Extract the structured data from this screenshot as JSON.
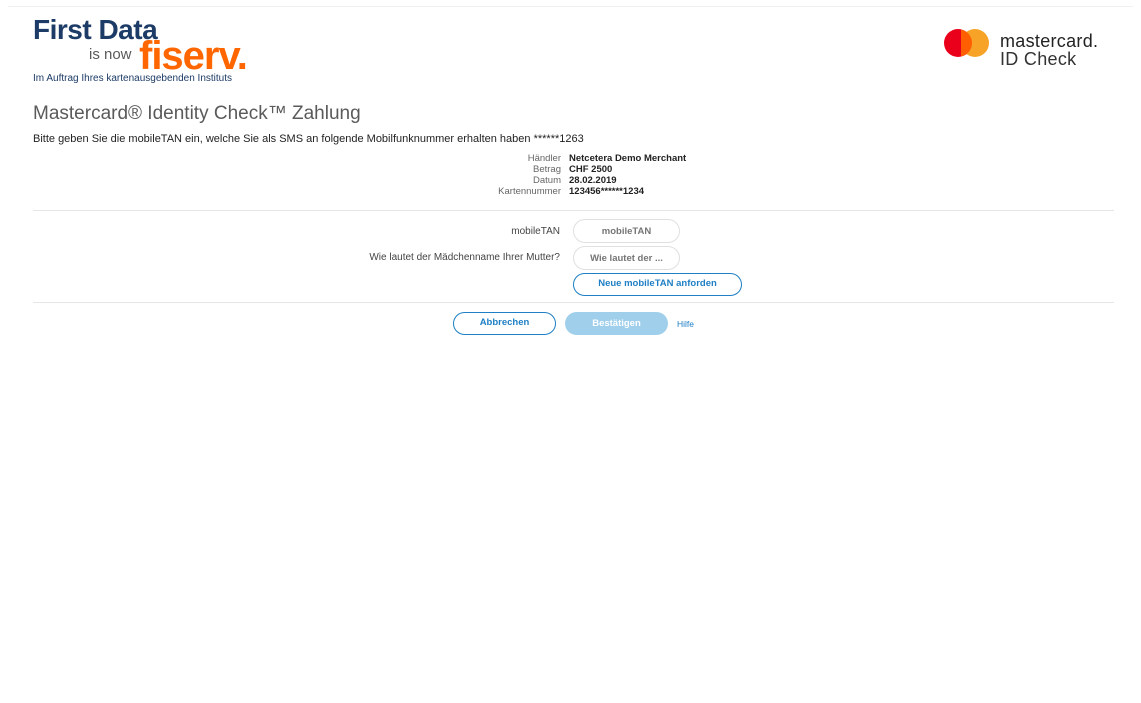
{
  "header": {
    "first_data": "First Data",
    "is_now": "is now",
    "fiserv": "fiserv.",
    "issuer_subtitle": "Im Auftrag Ihres kartenausgebenden Instituts",
    "mc_name": "mastercard.",
    "mc_sub": "ID Check"
  },
  "page": {
    "title": "Mastercard® Identity Check™ Zahlung",
    "instruction": "Bitte geben Sie die mobileTAN ein, welche Sie als SMS an folgende Mobilfunknummer erhalten haben ******1263"
  },
  "details": [
    {
      "label": "Händler",
      "value": "Netcetera Demo Merchant"
    },
    {
      "label": "Betrag",
      "value": "CHF 2500"
    },
    {
      "label": "Datum",
      "value": "28.02.2019"
    },
    {
      "label": "Kartennummer",
      "value": "123456******1234"
    }
  ],
  "form": {
    "mobiletan_label": "mobileTAN",
    "mobiletan_placeholder": "mobileTAN",
    "question_label": "Wie lautet der Mädchenname Ihrer Mutter?",
    "question_placeholder": "Wie lautet der ...",
    "resend_button": "Neue mobileTAN anforden"
  },
  "actions": {
    "cancel": "Abbrechen",
    "confirm": "Bestätigen",
    "help": "Hilfe"
  },
  "colors": {
    "brand_blue": "#1c3b66",
    "fiserv_orange": "#ff6600",
    "accent_blue": "#1e7fc4",
    "disabled_button": "#9fcfeb",
    "mc_red": "#eb001b",
    "mc_yellow": "#f79e1b"
  }
}
